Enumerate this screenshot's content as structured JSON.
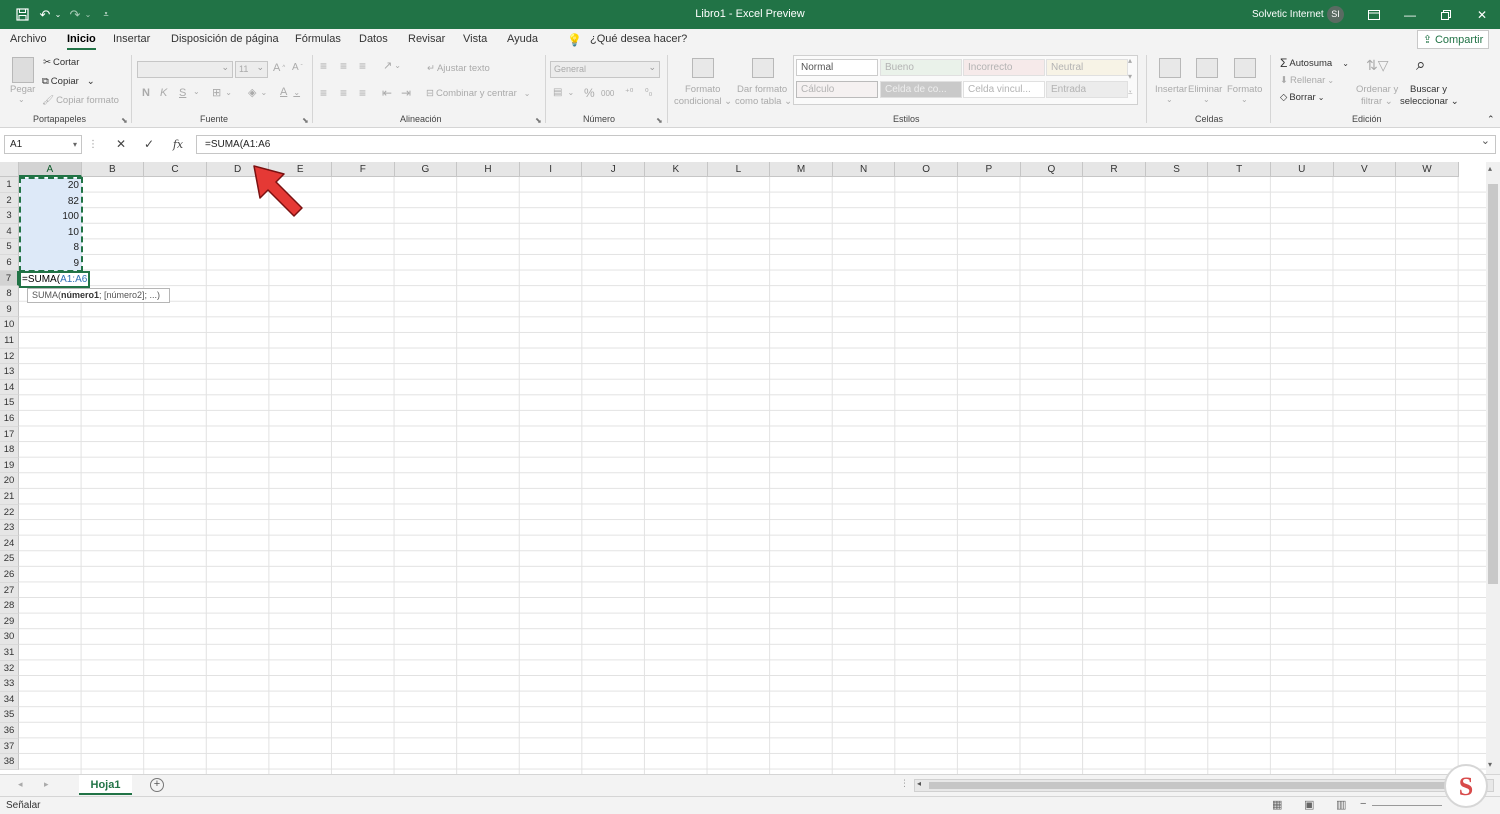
{
  "titlebar": {
    "title": "Libro1  -  Excel Preview",
    "account": "Solvetic Internet",
    "avatar_initials": "SI"
  },
  "menu": {
    "tabs": [
      "Archivo",
      "Inicio",
      "Insertar",
      "Disposición de página",
      "Fórmulas",
      "Datos",
      "Revisar",
      "Vista",
      "Ayuda"
    ],
    "search_placeholder": "¿Qué desea hacer?",
    "share": "Compartir"
  },
  "ribbon": {
    "clipboard": {
      "paste": "Pegar",
      "cut": "Cortar",
      "copy": "Copiar",
      "format_painter": "Copiar formato",
      "group": "Portapapeles"
    },
    "font": {
      "name": "",
      "size": "11",
      "bold": "N",
      "italic": "K",
      "underline": "S",
      "group": "Fuente"
    },
    "alignment": {
      "wrap": "Ajustar texto",
      "merge": "Combinar y centrar",
      "group": "Alineación"
    },
    "number": {
      "format": "General",
      "percent": "%",
      "thousands": "000",
      "group": "Número"
    },
    "styles": {
      "cond_format": "Formato condicional",
      "format_table": "Dar formato como tabla",
      "cells": [
        "Normal",
        "Bueno",
        "Incorrecto",
        "Neutral",
        "Cálculo",
        "Celda de co...",
        "Celda vincul...",
        "Entrada"
      ],
      "group": "Estilos"
    },
    "cells": {
      "insert": "Insertar",
      "delete": "Eliminar",
      "format": "Formato",
      "group": "Celdas"
    },
    "editing": {
      "autosum": "Autosuma",
      "fill": "Rellenar",
      "clear": "Borrar",
      "sort": "Ordenar y filtrar",
      "find": "Buscar y seleccionar",
      "group": "Edición"
    }
  },
  "formula_bar": {
    "name_box": "A1",
    "cancel": "✕",
    "enter": "✓",
    "fx": "fx",
    "formula": "=SUMA(A1:A6"
  },
  "columns": [
    "A",
    "B",
    "C",
    "D",
    "E",
    "F",
    "G",
    "H",
    "I",
    "J",
    "K",
    "L",
    "M",
    "N",
    "O",
    "P",
    "Q",
    "R",
    "S",
    "T",
    "U",
    "V",
    "W"
  ],
  "rows": [
    "1",
    "2",
    "3",
    "4",
    "5",
    "6",
    "7",
    "8",
    "9",
    "10",
    "11",
    "12",
    "13",
    "14",
    "15",
    "16",
    "17",
    "18",
    "19",
    "20",
    "21",
    "22",
    "23",
    "24",
    "25",
    "26",
    "27",
    "28",
    "29",
    "30",
    "31",
    "32",
    "33",
    "34",
    "35",
    "36",
    "37",
    "38"
  ],
  "cells": {
    "A1": "20",
    "A2": "82",
    "A3": "100",
    "A4": "10",
    "A5": "8",
    "A6": "9"
  },
  "edit_cell": {
    "prefix": "=SUMA(",
    "range": "A1:A6"
  },
  "tooltip": {
    "func": "SUMA(",
    "arg1": "número1",
    "rest": "; [número2]; ...)"
  },
  "sheets": {
    "active": "Hoja1"
  },
  "status": {
    "mode": "Señalar"
  },
  "colors": {
    "accent": "#217346",
    "arrow": "#e53935",
    "range_text": "#2e6fb5"
  }
}
